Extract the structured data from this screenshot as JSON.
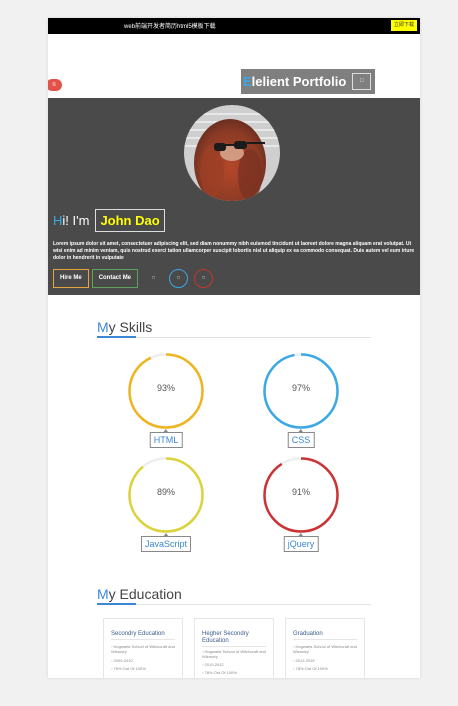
{
  "topbar": {
    "title": "web前端开发者简历html5模板下载",
    "button": "立即下载"
  },
  "header": {
    "menu_icon": "menu-icon",
    "brand_first": "E",
    "brand_rest": "lelient Portfolio",
    "toggle_icon": "menu-toggle-icon"
  },
  "hero": {
    "greeting_first": "H",
    "greeting_rest": "i! I'm",
    "name": "John Dao",
    "intro": "Lorem ipsum dolor sit amet, consectetuer adipiscing elit, sed diam nonummy nibh euismod tincidunt ut laoreet dolore magna aliquam erat volutpat. Ut wisi enim ad minim veniam, quis nostrud exerci tation ullamcorper suscipit lobortis nisl ut aliquip ex ea commodo consequat. Duis autem vel eum iriure dolor in hendrerit in vulputate",
    "hire_label": "Hire Me",
    "contact_label": "Contact Me",
    "social_icons": [
      "social-icon",
      "social-icon",
      "social-icon"
    ]
  },
  "skills": {
    "title_first": "M",
    "title_rest": "y Skills",
    "items": [
      {
        "label": "HTML",
        "percent": 93,
        "percent_text": "93%",
        "color": "#efb520"
      },
      {
        "label": "CSS",
        "percent": 97,
        "percent_text": "97%",
        "color": "#3ba9e3"
      },
      {
        "label": "JavaScript",
        "percent": 89,
        "percent_text": "89%",
        "color": "#dcd33c"
      },
      {
        "label": "jQuery",
        "percent": 91,
        "percent_text": "91%",
        "color": "#cc3334"
      }
    ]
  },
  "education": {
    "title_first": "M",
    "title_rest": "y Education",
    "cards": [
      {
        "title": "Secondry Education",
        "school": "Hogwarts School of Witchcraft and Wizardry",
        "years": "2009-2010",
        "score": "78% Out Of 100%"
      },
      {
        "title": "Hegher Secondry Education",
        "school": "Hogwarts School of Witchcraft and Wizardry",
        "years": "2010-2012",
        "score": "78% Out Of 100%"
      },
      {
        "title": "Graduation",
        "school": "Hogwarts School of Witchcraft and Wizardry",
        "years": "2012-2015",
        "score": "78% Out Of 100%"
      }
    ]
  },
  "colors": {
    "accent": "#3b87d4",
    "hero_bg": "#4a4a4a",
    "name_yellow": "#ffff00"
  }
}
